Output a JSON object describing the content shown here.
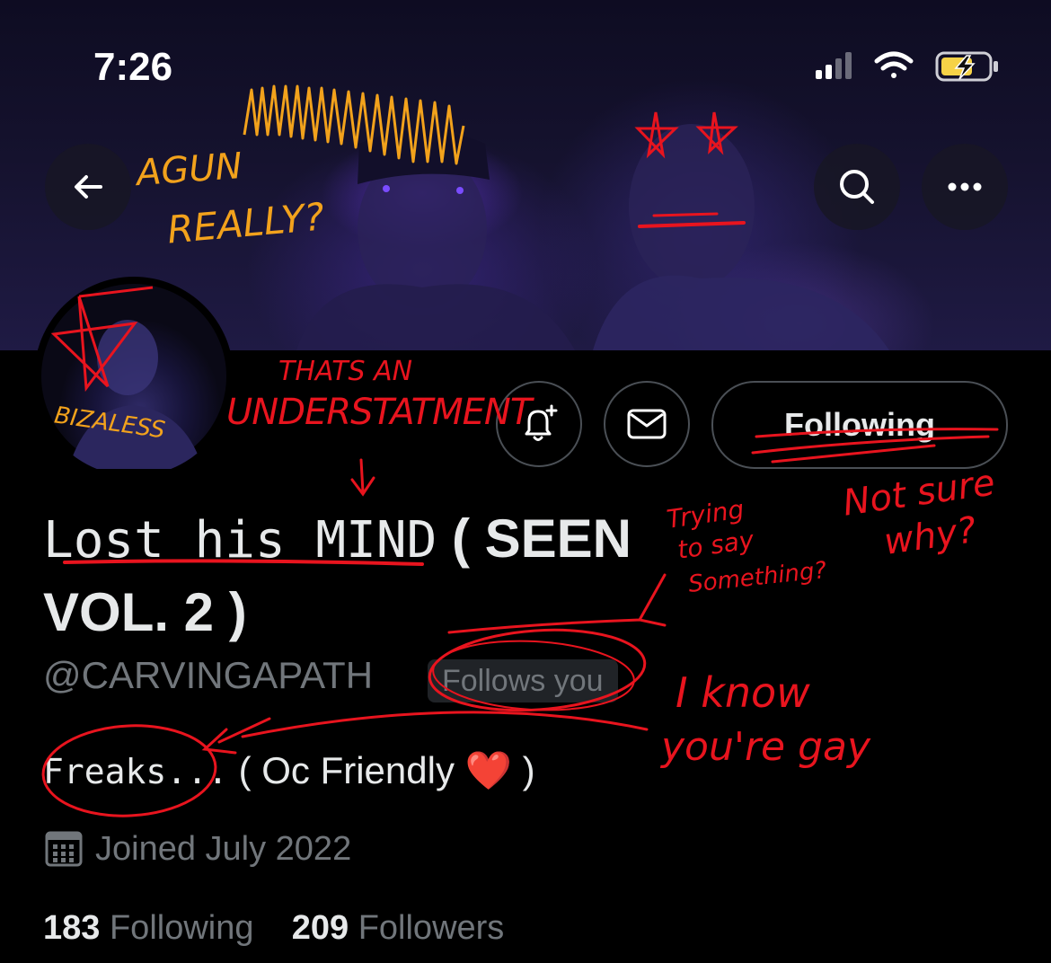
{
  "status_bar": {
    "time": "7:26"
  },
  "header": {
    "back_icon": "arrow-left-icon",
    "search_icon": "search-icon",
    "more_icon": "ellipsis-icon"
  },
  "actions": {
    "notify_icon": "bell-plus-icon",
    "message_icon": "envelope-icon",
    "following_label": "Following"
  },
  "profile": {
    "name_part1": "Lost his MIND",
    "name_part2": "( SEEN VOL. 2 )",
    "handle": "@CARVINGAPATH",
    "follows_you": "Follows you",
    "bio_part1": "Freaks...",
    "bio_part2": " ( Oc Friendly ❤️ )",
    "joined": "Joined July 2022",
    "following_count": "183",
    "following_label": "Following",
    "followers_count": "209",
    "followers_label": "Followers"
  },
  "annotations": {
    "colors": {
      "orange": "#f2a21c",
      "red": "#e8141e"
    },
    "again_really_1": "AGUN",
    "again_really_2": "REALLY?",
    "bizaless": "BIZALESS",
    "thats_an": "THATS AN",
    "understatment": "UNDERSTATMENT",
    "down_arrow": "↓",
    "trying_1": "Trying",
    "trying_2": "to say",
    "trying_3": "Something?",
    "not_sure_1": "Not sure",
    "not_sure_2": "why?",
    "i_know_1": "I know",
    "i_know_2": "you're gay"
  }
}
